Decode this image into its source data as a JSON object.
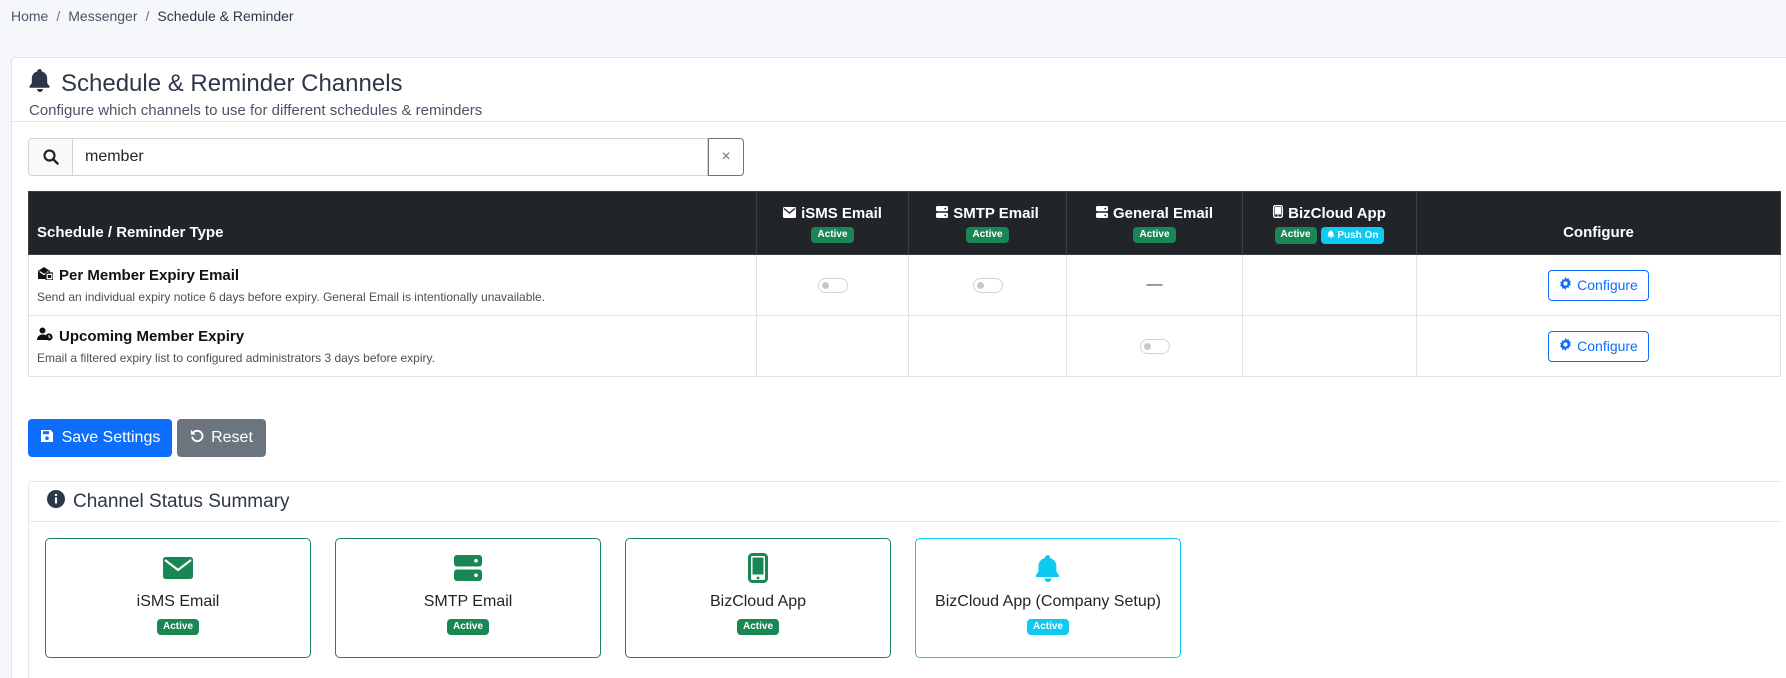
{
  "breadcrumb": {
    "home": "Home",
    "messenger": "Messenger",
    "current": "Schedule & Reminder",
    "sep": "/"
  },
  "header": {
    "title": "Schedule & Reminder Channels",
    "subtitle": "Configure which channels to use for different schedules & reminders"
  },
  "search": {
    "value": "member",
    "clear": "×"
  },
  "table": {
    "type_header": "Schedule / Reminder Type",
    "configure_header": "Configure",
    "channels": [
      {
        "name": "iSMS Email",
        "icon": "envelope-icon",
        "badge": "Active"
      },
      {
        "name": "SMTP Email",
        "icon": "server-icon",
        "badge": "Active"
      },
      {
        "name": "General Email",
        "icon": "server-icon",
        "badge": "Active"
      },
      {
        "name": "BizCloud App",
        "icon": "mobile-icon",
        "badge": "Active",
        "badge2": "Push On"
      }
    ],
    "rows": [
      {
        "title": "Per Member Expiry Email",
        "description": "Send an individual expiry notice 6 days before expiry. General Email is intentionally unavailable.",
        "general_na": "—",
        "configure": "Configure"
      },
      {
        "title": "Upcoming Member Expiry",
        "description": "Email a filtered expiry list to configured administrators 3 days before expiry.",
        "configure": "Configure"
      }
    ]
  },
  "actions": {
    "save": "Save Settings",
    "reset": "Reset"
  },
  "summary": {
    "title": "Channel Status Summary",
    "cards": [
      {
        "name": "iSMS Email",
        "badge": "Active",
        "icon": "envelope-icon"
      },
      {
        "name": "SMTP Email",
        "badge": "Active",
        "icon": "server-icon"
      },
      {
        "name": "BizCloud App",
        "badge": "Active",
        "icon": "mobile-icon"
      },
      {
        "name": "BizCloud App (Company Setup)",
        "badge": "Active",
        "icon": "bell-icon"
      }
    ]
  },
  "colors": {
    "primary": "#0d6efd",
    "success": "#198754",
    "info": "#0dcaf0",
    "secondary": "#6c757d",
    "dark": "#212529"
  }
}
